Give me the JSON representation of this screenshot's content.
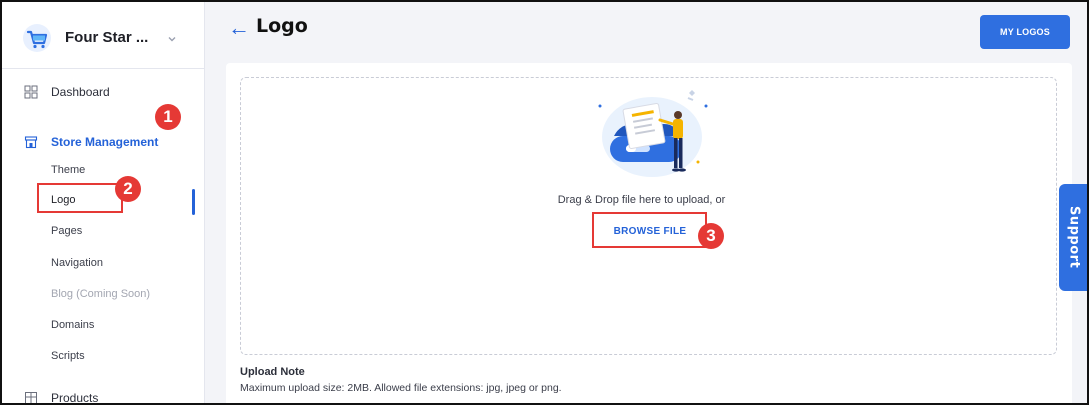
{
  "sidebar": {
    "store_name": "Four Star ...",
    "nav": [
      {
        "label": "Dashboard",
        "icon": "grid-icon"
      },
      {
        "label": "Store Management",
        "icon": "store-icon",
        "active": true
      }
    ],
    "sub_items": [
      {
        "label": "Theme",
        "state": "normal"
      },
      {
        "label": "Logo",
        "state": "current"
      },
      {
        "label": "Pages",
        "state": "normal"
      },
      {
        "label": "Navigation",
        "state": "normal"
      },
      {
        "label": "Blog (Coming Soon)",
        "state": "disabled"
      },
      {
        "label": "Domains",
        "state": "normal"
      },
      {
        "label": "Scripts",
        "state": "normal"
      }
    ],
    "products": {
      "label": "Products",
      "icon": "products-icon"
    }
  },
  "header": {
    "back_icon": "←",
    "title": "Logo",
    "my_logos_label": "MY LOGOS"
  },
  "upload": {
    "illustration": "upload-illustration",
    "drag_text": "Drag & Drop file here to upload, or",
    "browse_label": "BROWSE FILE",
    "note_title": "Upload Note",
    "note_text": "Maximum upload size: 2MB. Allowed file extensions: jpg, jpeg or png."
  },
  "support": {
    "label": "Support"
  },
  "annotations": {
    "m1": "1",
    "m2": "2",
    "m3": "3"
  },
  "colors": {
    "accent": "#2f6fe0",
    "active_text": "#2462d8",
    "annotation": "#e53935",
    "background": "#f3f4f8"
  }
}
